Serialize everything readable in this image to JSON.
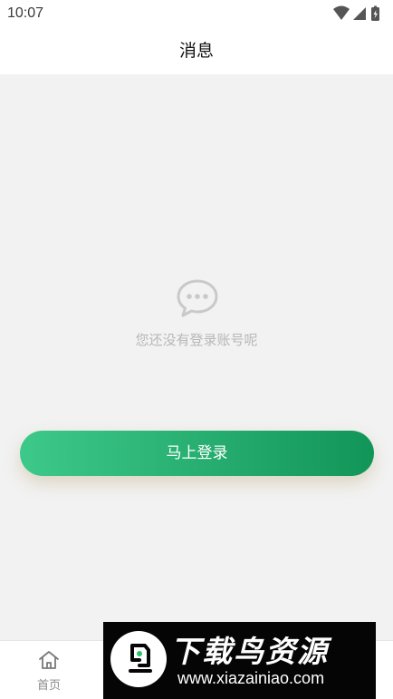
{
  "status_bar": {
    "time": "10:07",
    "icons": [
      "wifi-icon",
      "cell-signal-icon",
      "battery-icon"
    ]
  },
  "header": {
    "title": "消息"
  },
  "empty_state": {
    "icon": "chat-bubble-icon",
    "message": "您还没有登录账号呢"
  },
  "login": {
    "button_label": "马上登录",
    "gradient_colors": [
      "#3dc98a",
      "#129558"
    ]
  },
  "tab_bar": {
    "items": [
      {
        "label": "首页",
        "icon": "home-icon"
      }
    ]
  },
  "watermark": {
    "title": "下载鸟资源",
    "url": "www.xiazainiao.com"
  }
}
